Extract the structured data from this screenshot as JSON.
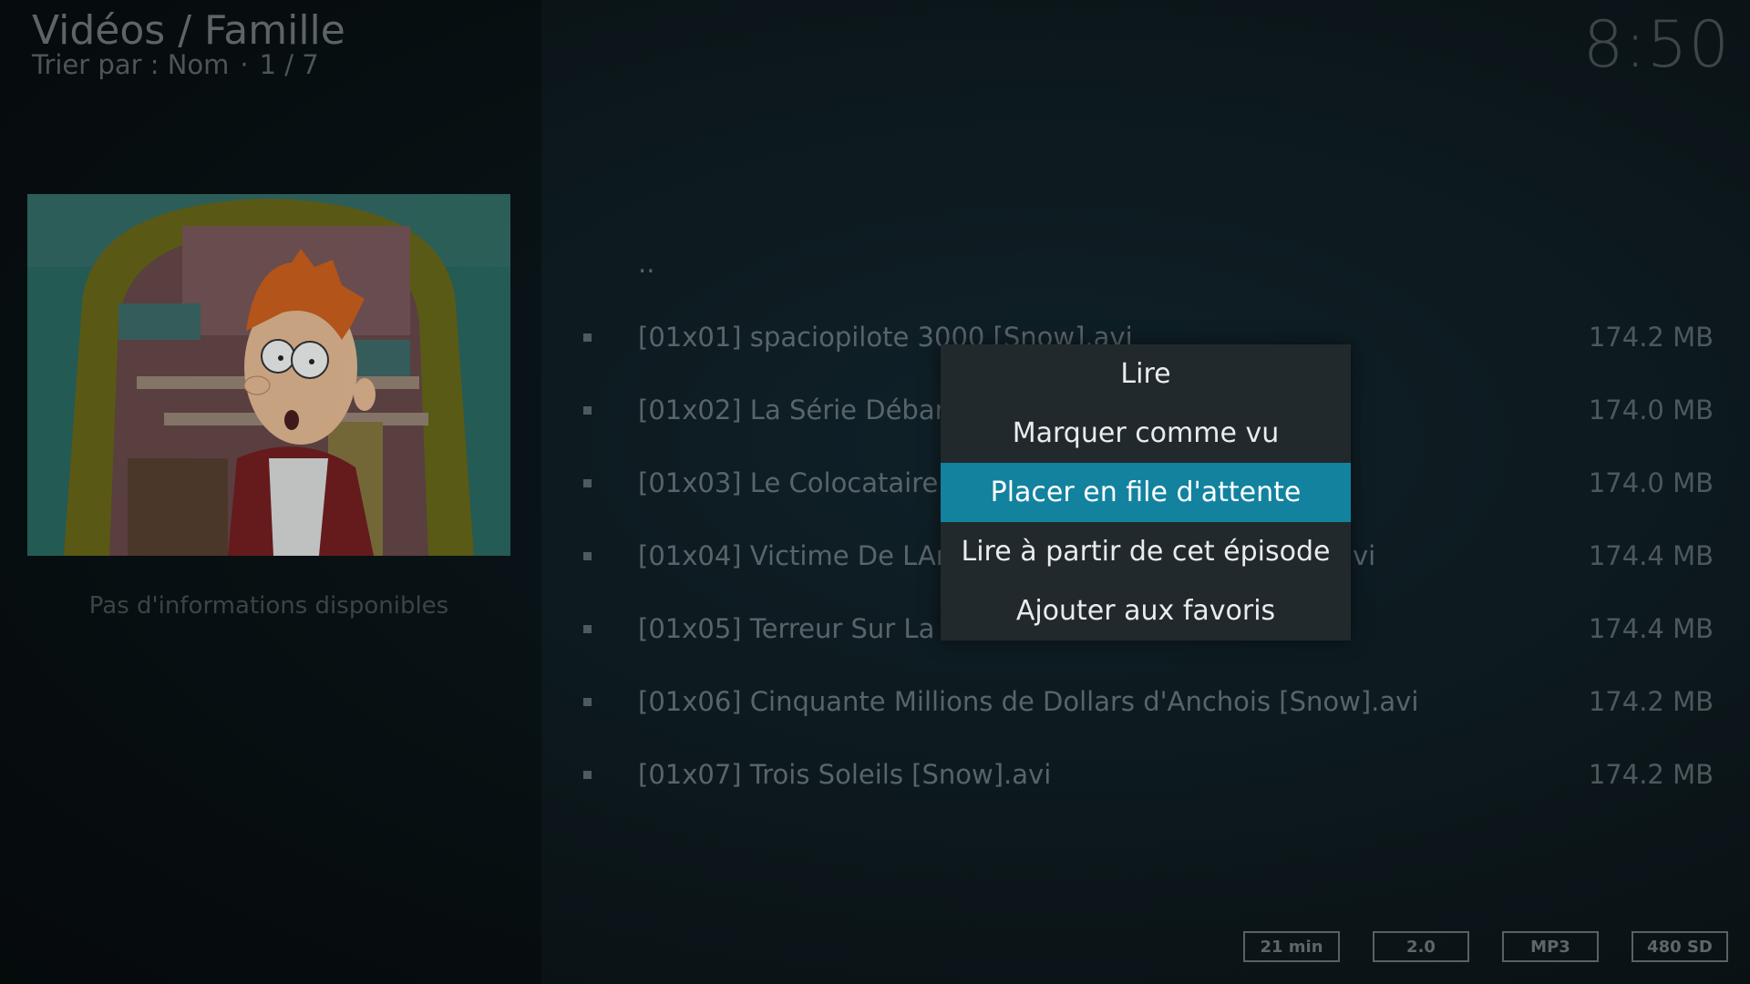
{
  "header": {
    "title": "Vidéos / Famille",
    "sort_label": "Trier par : Nom",
    "separator": "·",
    "position": "1 / 7",
    "clock": "8:50"
  },
  "info_panel": {
    "no_info_text": "Pas d'informations disponibles"
  },
  "file_list": {
    "parent_item": "..",
    "items": [
      {
        "name": "[01x01] spaciopilote 3000 [Snow].avi",
        "size": "174.2 MB"
      },
      {
        "name": "[01x02] La Série Débarqu",
        "size": "174.0 MB"
      },
      {
        "name": "[01x03] Le Colocataire [Sn",
        "size": "174.0 MB"
      },
      {
        "name": "[01x04] Victime De LAmo",
        "name_tail": "vi",
        "size": "174.4 MB"
      },
      {
        "name": "[01x05] Terreur Sur La Pla",
        "size": "174.4 MB"
      },
      {
        "name": "[01x06] Cinquante Millions de Dollars d'Anchois [Snow].avi",
        "size": "174.2 MB"
      },
      {
        "name": "[01x07] Trois Soleils [Snow].avi",
        "size": "174.2 MB"
      }
    ]
  },
  "context_menu": {
    "items": [
      {
        "label": "Lire"
      },
      {
        "label": "Marquer comme vu"
      },
      {
        "label": "Placer en file d'attente",
        "selected": true
      },
      {
        "label": "Lire à partir de cet épisode"
      },
      {
        "label": "Ajouter aux favoris"
      }
    ]
  },
  "badges": {
    "duration": "21 min",
    "audio_channels": "2.0",
    "audio_codec": "MP3",
    "resolution": "480 SD"
  },
  "colors": {
    "selected_accent": "#12829f",
    "menu_background": "#22292c"
  }
}
